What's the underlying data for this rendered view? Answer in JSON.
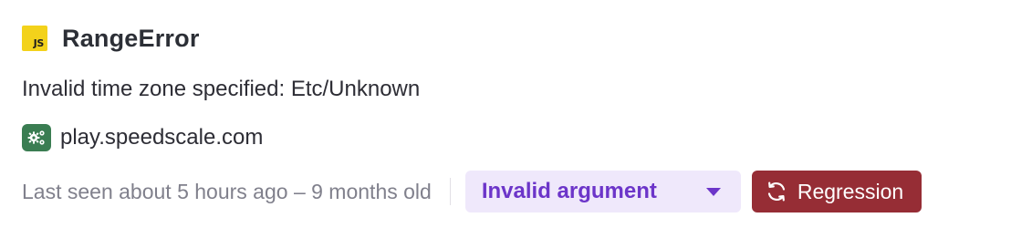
{
  "issue": {
    "platform_icon": "javascript-icon",
    "platform_icon_text": "JS",
    "error_type": "RangeError",
    "message": "Invalid time zone specified: Etc/Unknown",
    "project": {
      "icon": "gears-icon",
      "name": "play.speedscale.com"
    },
    "last_seen": "Last seen about 5 hours ago – 9 months old",
    "tag": {
      "label": "Invalid argument",
      "icon": "caret-down-icon"
    },
    "status_badge": {
      "label": "Regression",
      "icon": "refresh-icon"
    }
  },
  "colors": {
    "js_badge": "#f3d21b",
    "project_icon_bg": "#3a7d52",
    "tag_bg": "#efe8fb",
    "tag_text": "#6c35c9",
    "regression_bg": "#962d35",
    "muted_text": "#80808c"
  }
}
